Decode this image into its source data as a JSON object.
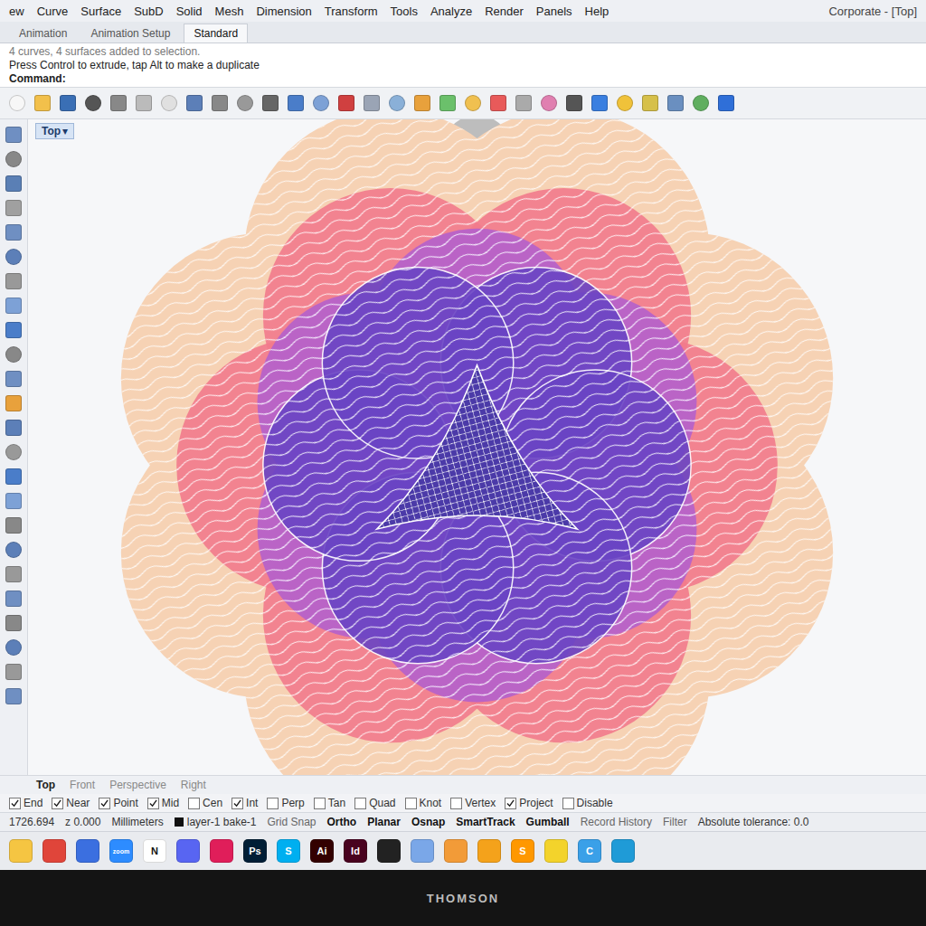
{
  "window": {
    "title": "Corporate - [Top]"
  },
  "menu": [
    {
      "label": "ew"
    },
    {
      "label": "Curve"
    },
    {
      "label": "Surface"
    },
    {
      "label": "SubD"
    },
    {
      "label": "Solid"
    },
    {
      "label": "Mesh"
    },
    {
      "label": "Dimension"
    },
    {
      "label": "Transform"
    },
    {
      "label": "Tools"
    },
    {
      "label": "Analyze"
    },
    {
      "label": "Render"
    },
    {
      "label": "Panels"
    },
    {
      "label": "Help"
    }
  ],
  "toolbar_tabs": [
    {
      "label": "Animation",
      "selected": false
    },
    {
      "label": "Animation Setup",
      "selected": false
    },
    {
      "label": "Standard",
      "selected": true
    }
  ],
  "command": {
    "history": "4 curves, 4 surfaces added to selection.",
    "hint": "Press Control to extrude, tap Alt to make a duplicate",
    "label": "Command:"
  },
  "viewport": {
    "label": "Top",
    "dropdown": "▾"
  },
  "view_tabs": [
    {
      "label": "Top",
      "selected": true
    },
    {
      "label": "Front",
      "selected": false
    },
    {
      "label": "Perspective",
      "selected": false
    },
    {
      "label": "Right",
      "selected": false
    }
  ],
  "osnaps": [
    {
      "label": "End",
      "checked": true
    },
    {
      "label": "Near",
      "checked": true
    },
    {
      "label": "Point",
      "checked": true
    },
    {
      "label": "Mid",
      "checked": true
    },
    {
      "label": "Cen",
      "checked": false
    },
    {
      "label": "Int",
      "checked": true
    },
    {
      "label": "Perp",
      "checked": false
    },
    {
      "label": "Tan",
      "checked": false
    },
    {
      "label": "Quad",
      "checked": false
    },
    {
      "label": "Knot",
      "checked": false
    },
    {
      "label": "Vertex",
      "checked": false
    },
    {
      "label": "Project",
      "checked": true
    },
    {
      "label": "Disable",
      "checked": false
    }
  ],
  "status_bar": {
    "coordinates": "1726.694",
    "z": "z 0.000",
    "units": "Millimeters",
    "layer": "layer-1 bake-1",
    "layer_color": "#111111",
    "toggles": [
      {
        "label": "Grid Snap",
        "on": false
      },
      {
        "label": "Ortho",
        "on": true
      },
      {
        "label": "Planar",
        "on": true
      },
      {
        "label": "Osnap",
        "on": true
      },
      {
        "label": "SmartTrack",
        "on": true
      },
      {
        "label": "Gumball",
        "on": true
      },
      {
        "label": "Record History",
        "on": false
      },
      {
        "label": "Filter",
        "on": false
      }
    ],
    "tolerance": "Absolute tolerance: 0.0"
  },
  "taskbar": {
    "apps": [
      {
        "label": "",
        "color": "#f5c542"
      },
      {
        "label": "",
        "color": "#e0453a"
      },
      {
        "label": "",
        "color": "#3b6fe0"
      },
      {
        "label": "zoom",
        "color": "#2d8cff"
      },
      {
        "label": "N",
        "color": "#ffffff"
      },
      {
        "label": "",
        "color": "#5865f2"
      },
      {
        "label": "",
        "color": "#e01e5a"
      },
      {
        "label": "Ps",
        "color": "#001e36"
      },
      {
        "label": "S",
        "color": "#00aff0"
      },
      {
        "label": "Ai",
        "color": "#330000"
      },
      {
        "label": "Id",
        "color": "#49021f"
      },
      {
        "label": "",
        "color": "#222222"
      },
      {
        "label": "",
        "color": "#7aa7e8"
      },
      {
        "label": "",
        "color": "#f29b38"
      },
      {
        "label": "",
        "color": "#f4a21b"
      },
      {
        "label": "S",
        "color": "#ff9800"
      },
      {
        "label": "",
        "color": "#f3d32b"
      },
      {
        "label": "C",
        "color": "#3aa0e8"
      },
      {
        "label": "",
        "color": "#1f9bd7"
      }
    ]
  },
  "monitor": {
    "brand": "THOMSON"
  }
}
